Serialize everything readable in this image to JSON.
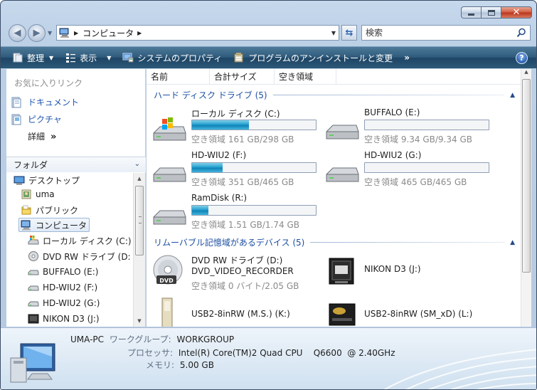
{
  "window": {
    "caption_buttons": [
      "minimize-icon",
      "maximize-icon",
      "close-icon"
    ]
  },
  "address": {
    "crumb": "コンピュータ",
    "search_placeholder": "検索"
  },
  "toolbar": {
    "organize": "整理",
    "views": "表示",
    "system_properties": "システムのプロパティ",
    "uninstall": "プログラムのアンインストールと変更",
    "more": "»"
  },
  "favorites": {
    "header": "お気に入りリンク",
    "items": [
      {
        "label": "ドキュメント",
        "icon": "documents-icon"
      },
      {
        "label": "ピクチャ",
        "icon": "pictures-icon"
      }
    ],
    "more_label": "詳細",
    "more_chevron": "»"
  },
  "folders": {
    "header": "フォルダ",
    "tree": [
      {
        "label": "デスクトップ",
        "icon": "desktop-icon",
        "level": 0
      },
      {
        "label": "uma",
        "icon": "user-folder-icon",
        "level": 1
      },
      {
        "label": "パブリック",
        "icon": "folder-icon",
        "level": 1
      },
      {
        "label": "コンピュータ",
        "icon": "computer-icon",
        "level": 1,
        "selected": true
      },
      {
        "label": "ローカル ディスク (C:)",
        "icon": "system-drive-icon",
        "level": 2
      },
      {
        "label": "DVD RW ドライブ (D:",
        "icon": "dvd-drive-icon",
        "level": 2
      },
      {
        "label": "BUFFALO (E:)",
        "icon": "hard-drive-icon",
        "level": 2
      },
      {
        "label": "HD-WIU2 (F:)",
        "icon": "hard-drive-icon",
        "level": 2
      },
      {
        "label": "HD-WIU2 (G:)",
        "icon": "hard-drive-icon",
        "level": 2
      },
      {
        "label": "NIKON D3 (J:)",
        "icon": "camera-icon",
        "level": 2
      }
    ]
  },
  "columns": [
    "名前",
    "合計サイズ",
    "空き領域"
  ],
  "groups": {
    "hdd": "ハード ディスク ドライブ (5)",
    "removable": "リムーバブル記憶域があるデバイス (5)"
  },
  "hard_drives": [
    {
      "name": "ローカル ディスク (C:)",
      "free_text": "空き領域 161 GB/298 GB",
      "used_fraction": 0.46,
      "icon": "windows-drive-icon"
    },
    {
      "name": "BUFFALO (E:)",
      "free_text": "空き領域 9.34 GB/9.34 GB",
      "used_fraction": 0.0,
      "icon": "hard-drive-icon"
    },
    {
      "name": "HD-WIU2 (F:)",
      "free_text": "空き領域 351 GB/465 GB",
      "used_fraction": 0.245,
      "icon": "hard-drive-icon"
    },
    {
      "name": "HD-WIU2 (G:)",
      "free_text": "空き領域 465 GB/465 GB",
      "used_fraction": 0.0,
      "icon": "hard-drive-icon"
    },
    {
      "name": "RamDisk (R:)",
      "free_text": "空き領域 1.51 GB/1.74 GB",
      "used_fraction": 0.13,
      "icon": "hard-drive-icon"
    }
  ],
  "removable": [
    {
      "name": "DVD RW ドライブ (D:)",
      "label2": "DVD_VIDEO_RECORDER",
      "free_text": "空き領域 0 バイト/2.05 GB",
      "icon": "dvd-disc-icon"
    },
    {
      "name": "NIKON D3 (J:)",
      "icon": "compact-flash-icon"
    },
    {
      "name": "USB2-8inRW (M.S.) (K:)",
      "icon": "memory-stick-icon"
    },
    {
      "name": "USB2-8inRW (SM_xD) (L:)",
      "icon": "xd-card-icon"
    }
  ],
  "details": {
    "computer_name": "UMA-PC",
    "workgroup_label": "ワークグループ:",
    "workgroup": "WORKGROUP",
    "processor_label": "プロセッサ:",
    "processor": "Intel(R) Core(TM)2 Quad CPU    Q6600  @ 2.40GHz",
    "memory_label": "メモリ:",
    "memory": "5.00 GB"
  },
  "colors": {
    "link_blue": "#1f57b0",
    "bar_fill": "#26a0d0",
    "cmdbar": "#2f5a7b"
  }
}
